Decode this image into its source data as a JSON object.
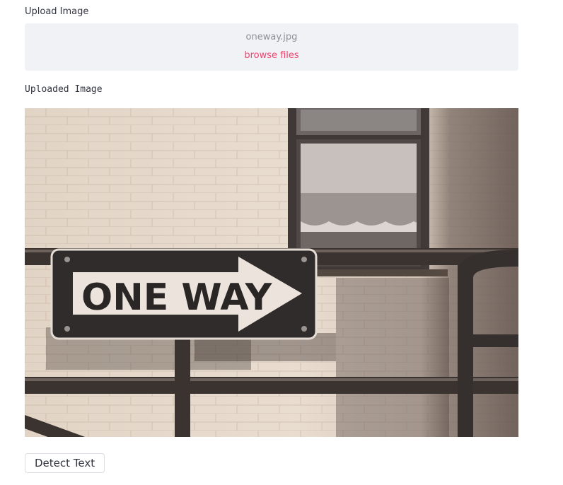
{
  "uploader": {
    "label": "Upload Image",
    "file_name": "oneway.jpg",
    "browse_label": "browse files"
  },
  "image": {
    "caption": "Uploaded Image",
    "sign_text": "ONE WAY"
  },
  "actions": {
    "detect_label": "Detect Text"
  }
}
